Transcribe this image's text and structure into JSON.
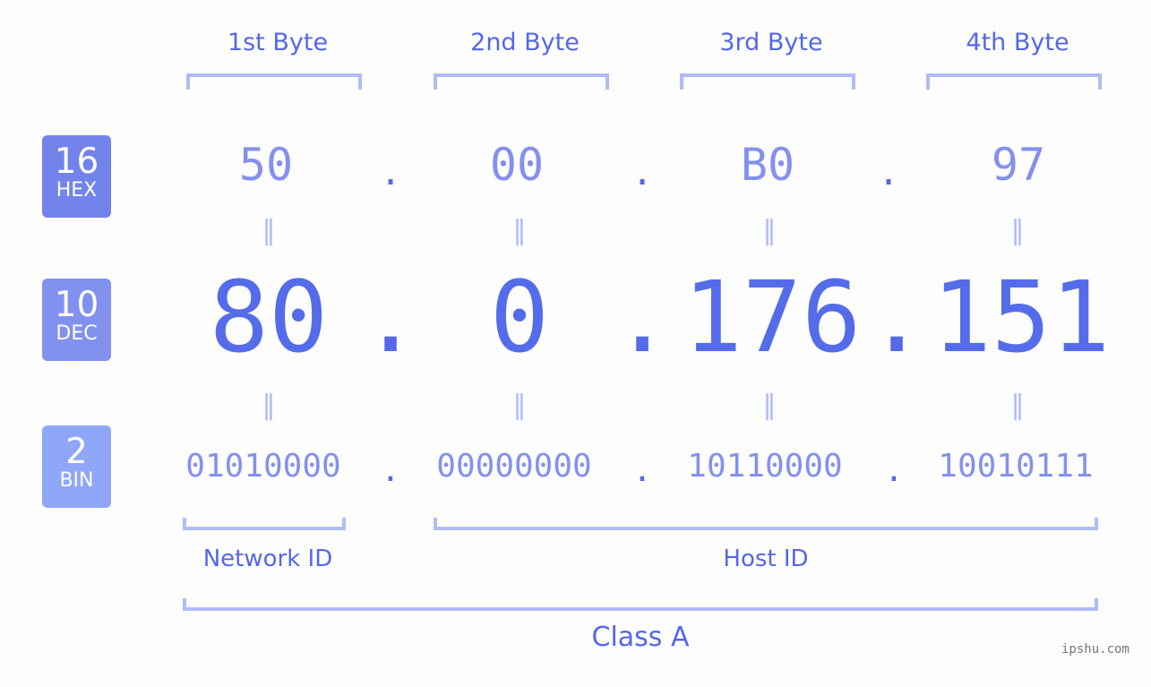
{
  "byte_headers": [
    "1st Byte",
    "2nd Byte",
    "3rd Byte",
    "4th Byte"
  ],
  "badges": {
    "hex": {
      "num": "16",
      "label": "HEX",
      "color": "#7283ea"
    },
    "dec": {
      "num": "10",
      "label": "DEC",
      "color": "#8191f0"
    },
    "bin": {
      "num": "2",
      "label": "BIN",
      "color": "#90a6f8"
    }
  },
  "hex_values": [
    "50",
    "00",
    "B0",
    "97"
  ],
  "dec_values": [
    "80",
    "0",
    "176",
    "151"
  ],
  "bin_values": [
    "01010000",
    "00000000",
    "10110000",
    "10010111"
  ],
  "separator": ".",
  "equals_sign": "=",
  "labels": {
    "network_id": "Network ID",
    "host_id": "Host ID",
    "class": "Class A"
  },
  "watermark": "ipshu.com",
  "colors": {
    "accent": "#5468e8",
    "light_accent": "#8490ef",
    "bracket": "#b1bbf6"
  }
}
